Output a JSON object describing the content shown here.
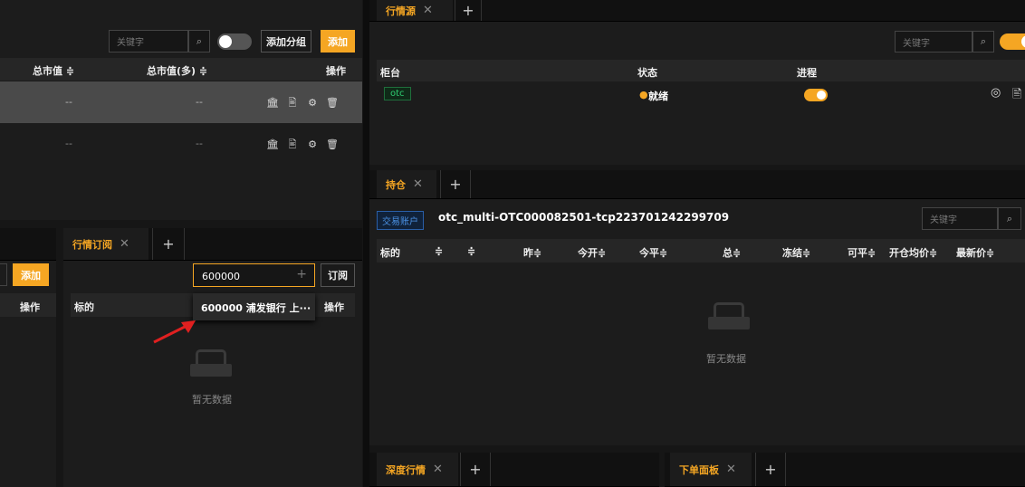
{
  "left_top": {
    "search_placeholder": "关键字",
    "add_group_label": "添加分组",
    "add_label": "添加",
    "columns": [
      "总市值 ≑",
      "总市值(多) ≑",
      "操作"
    ],
    "rows": [
      {
        "market_value": "--",
        "market_value_long": "--"
      },
      {
        "market_value": "--",
        "market_value_long": "--"
      }
    ]
  },
  "left_bottom": {
    "add_label": "添加",
    "op_label": "操作"
  },
  "sub_panel": {
    "tab_label": "行情订阅",
    "input_value": "600000",
    "subscribe_label": "订阅",
    "col_target": "标的",
    "col_op": "操作",
    "suggestion": "600000 浦发银行 上···",
    "empty_text": "暂无数据"
  },
  "source_panel": {
    "tab_label": "行情源",
    "search_placeholder": "关键字",
    "columns": [
      "柜台",
      "状态",
      "进程"
    ],
    "rows": [
      {
        "counter": "otc",
        "status": "就绪"
      }
    ]
  },
  "positions_panel": {
    "tab_label": "持仓",
    "account_badge": "交易账户",
    "account_name": "otc_multi-OTC000082501-tcp223701242299709",
    "search_placeholder": "关键字",
    "columns": [
      "标的",
      "≑",
      "≑",
      "昨≑",
      "今开≑",
      "今平≑",
      "总≑",
      "冻结≑",
      "可平≑",
      "开仓均价≑",
      "最新价≑"
    ],
    "empty_text": "暂无数据"
  },
  "bottom_tabs": {
    "depth_label": "深度行情",
    "order_label": "下单面板"
  },
  "colors": {
    "accent": "#f5a623",
    "background": "#1c1c1c",
    "status_ready": "#f5a623",
    "otc_tag": "#2ecc71"
  }
}
